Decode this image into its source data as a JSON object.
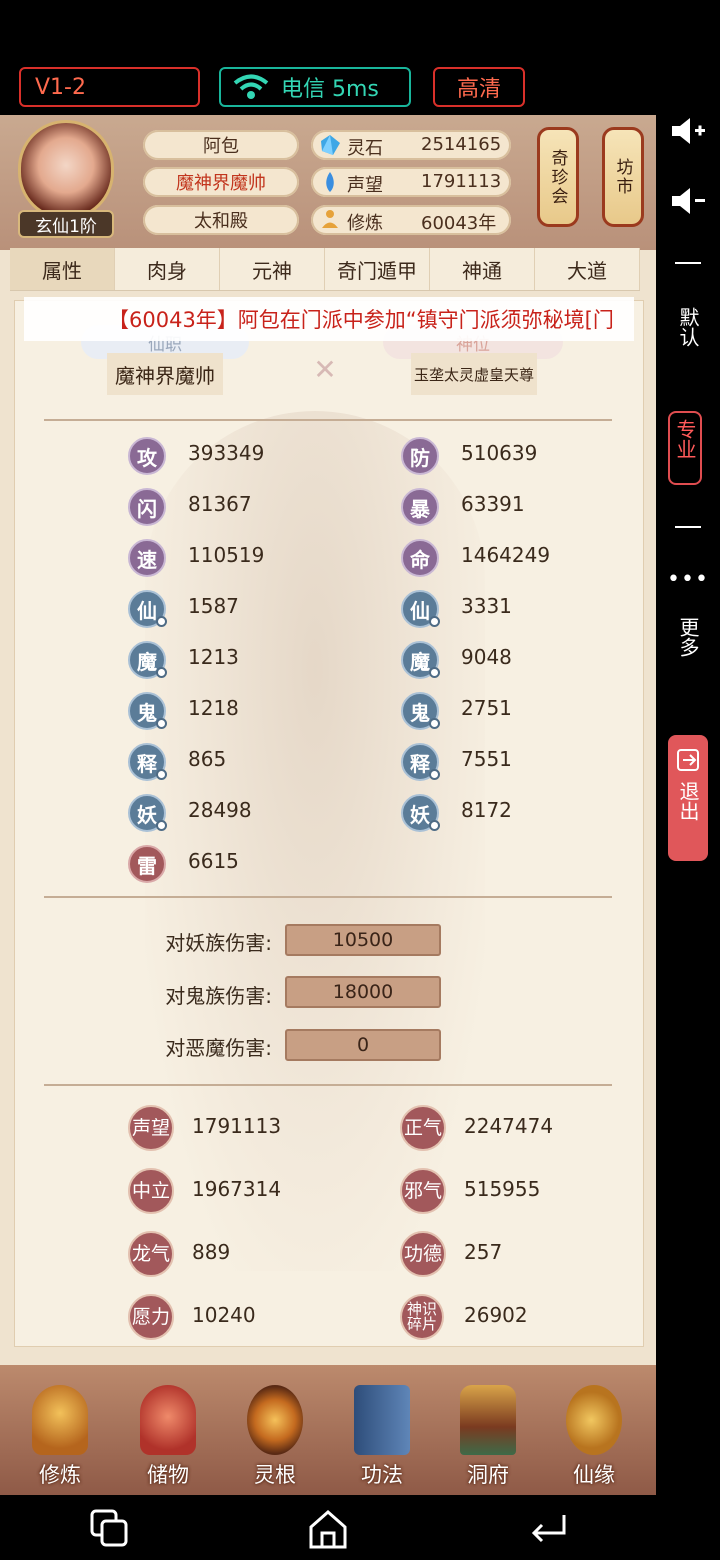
{
  "status_chips": {
    "version": "V1-2",
    "network": "电信 5ms",
    "quality": "高清"
  },
  "player": {
    "realm": "玄仙1阶",
    "name": "阿包",
    "title": "魔神界魔帅",
    "location": "太和殿"
  },
  "resources": [
    {
      "icon": "crystal-icon",
      "label": "灵石",
      "value": "2514165"
    },
    {
      "icon": "prestige-icon",
      "label": "声望",
      "value": "1791113"
    },
    {
      "icon": "meditation-icon",
      "label": "修炼",
      "value": "60043年"
    }
  ],
  "lanterns": [
    "奇珍会",
    "坊市"
  ],
  "tabs": [
    "属性",
    "肉身",
    "元神",
    "奇门遁甲",
    "神通",
    "大道"
  ],
  "active_tab": "属性",
  "ticker": "【60043年】阿包在门派中参加“镇守门派须弥秘境[门",
  "ranks": {
    "left_pill": "仙职",
    "left_value": "魔神界魔帅",
    "right_pill": "神位",
    "right_value": "玉垄太灵虚皇天尊"
  },
  "stats_left": [
    {
      "glyph": "攻",
      "value": "393349",
      "style": "purple"
    },
    {
      "glyph": "闪",
      "value": "81367",
      "style": "purple"
    },
    {
      "glyph": "速",
      "value": "110519",
      "style": "purple"
    },
    {
      "glyph": "仙",
      "value": "1587",
      "style": "blue"
    },
    {
      "glyph": "魔",
      "value": "1213",
      "style": "blue"
    },
    {
      "glyph": "鬼",
      "value": "1218",
      "style": "blue"
    },
    {
      "glyph": "释",
      "value": "865",
      "style": "blue"
    },
    {
      "glyph": "妖",
      "value": "28498",
      "style": "blue"
    },
    {
      "glyph": "雷",
      "value": "6615",
      "style": "red"
    }
  ],
  "stats_right": [
    {
      "glyph": "防",
      "value": "510639",
      "style": "purple"
    },
    {
      "glyph": "暴",
      "value": "63391",
      "style": "purple"
    },
    {
      "glyph": "命",
      "value": "1464249",
      "style": "purple"
    },
    {
      "glyph": "仙",
      "value": "3331",
      "style": "blue"
    },
    {
      "glyph": "魔",
      "value": "9048",
      "style": "blue"
    },
    {
      "glyph": "鬼",
      "value": "2751",
      "style": "blue"
    },
    {
      "glyph": "释",
      "value": "7551",
      "style": "blue"
    },
    {
      "glyph": "妖",
      "value": "8172",
      "style": "blue"
    }
  ],
  "damage": [
    {
      "label": "对妖族伤害:",
      "value": "10500"
    },
    {
      "label": "对鬼族伤害:",
      "value": "18000"
    },
    {
      "label": "对恶魔伤害:",
      "value": "0"
    }
  ],
  "reputation_left": [
    {
      "glyph": "声望",
      "value": "1791113"
    },
    {
      "glyph": "中立",
      "value": "1967314"
    },
    {
      "glyph": "龙气",
      "value": "889"
    },
    {
      "glyph": "愿力",
      "value": "10240"
    }
  ],
  "reputation_right": [
    {
      "glyph": "正气",
      "value": "2247474"
    },
    {
      "glyph": "邪气",
      "value": "515955"
    },
    {
      "glyph": "功德",
      "value": "257"
    },
    {
      "glyph": "神识碎片",
      "value": "26902"
    }
  ],
  "bottom_nav": [
    "修炼",
    "储物",
    "灵根",
    "功法",
    "洞府",
    "仙缘"
  ],
  "side_menu": {
    "default": "默认",
    "pro": "专业",
    "more": "更多",
    "exit": "退出"
  },
  "colors": {
    "accent_red": "#d9302a",
    "accent_green": "#19b59b",
    "panel": "#f7f0e2"
  }
}
